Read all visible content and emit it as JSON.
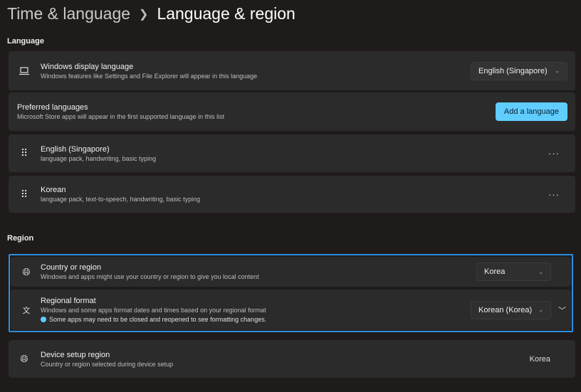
{
  "breadcrumb": {
    "parent": "Time & language",
    "current": "Language & region"
  },
  "language": {
    "heading": "Language",
    "display": {
      "title": "Windows display language",
      "subtitle": "Windows features like Settings and File Explorer will appear in this language",
      "value": "English (Singapore)"
    },
    "preferred": {
      "title": "Preferred languages",
      "subtitle": "Microsoft Store apps will appear in the first supported language in this list",
      "button": "Add a language"
    },
    "items": [
      {
        "title": "English (Singapore)",
        "subtitle": "language pack, handwriting, basic typing"
      },
      {
        "title": "Korean",
        "subtitle": "language pack, text-to-speech, handwriting, basic typing"
      }
    ]
  },
  "region": {
    "heading": "Region",
    "country": {
      "title": "Country or region",
      "subtitle": "Windows and apps might use your country or region to give you local content",
      "value": "Korea"
    },
    "format": {
      "title": "Regional format",
      "subtitle": "Windows and some apps format dates and times based on your regional format",
      "info": "Some apps may need to be closed and reopened to see formatting changes.",
      "value": "Korean (Korea)"
    },
    "device": {
      "title": "Device setup region",
      "subtitle": "Country or region selected during device setup",
      "value": "Korea"
    }
  },
  "colors": {
    "accent": "#60cdff",
    "highlight": "#2b8fe0"
  }
}
